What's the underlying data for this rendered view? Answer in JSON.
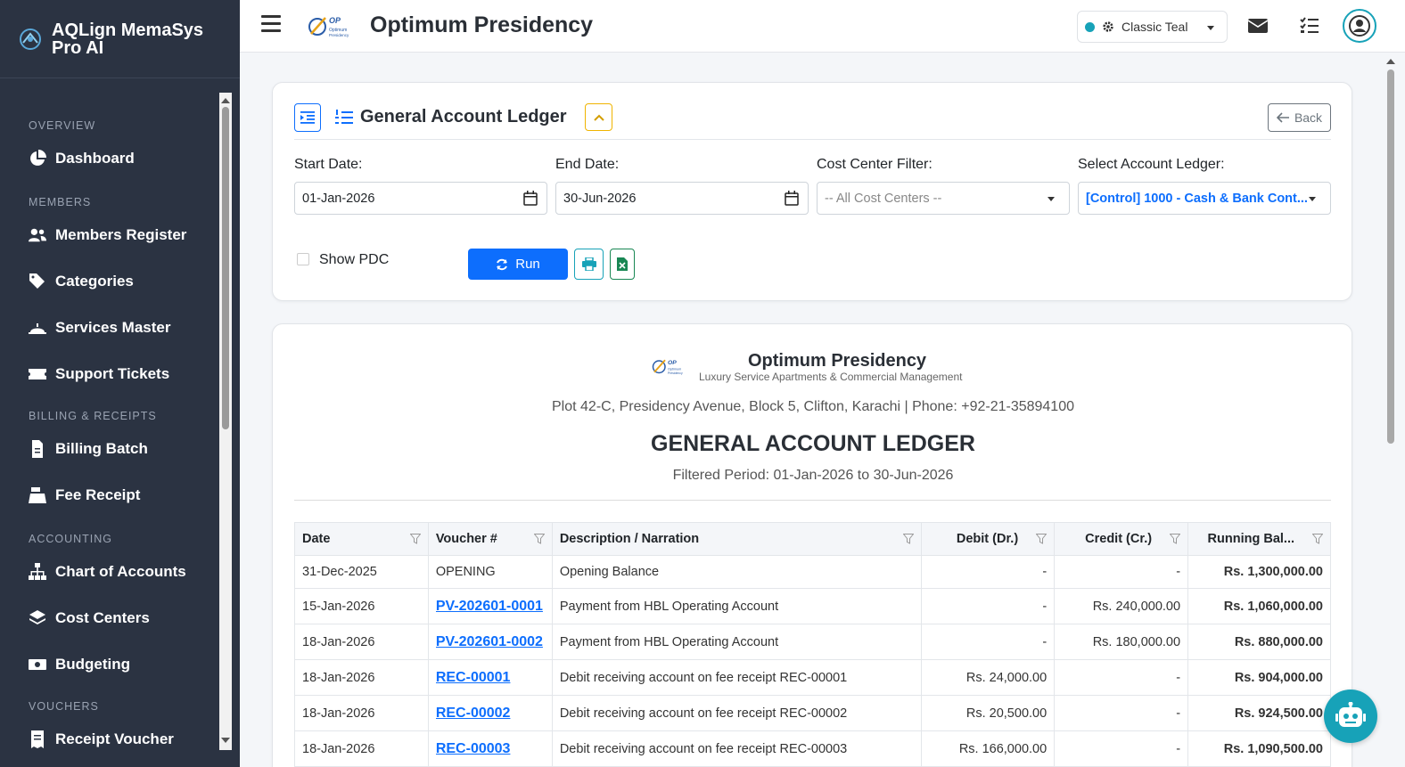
{
  "app": {
    "title": "AQLign MemaSys Pro AI"
  },
  "sidebar": {
    "sections": [
      {
        "label": "OVERVIEW"
      },
      {
        "label": "MEMBERS"
      },
      {
        "label": "BILLING & RECEIPTS"
      },
      {
        "label": "ACCOUNTING"
      },
      {
        "label": "VOUCHERS"
      }
    ],
    "items": [
      {
        "label": "Dashboard",
        "icon": "chart-pie-icon"
      },
      {
        "label": "Members Register",
        "icon": "users-icon"
      },
      {
        "label": "Categories",
        "icon": "tags-icon"
      },
      {
        "label": "Services Master",
        "icon": "service-bell-icon"
      },
      {
        "label": "Support Tickets",
        "icon": "ticket-icon"
      },
      {
        "label": "Billing Batch",
        "icon": "file-invoice-icon"
      },
      {
        "label": "Fee Receipt",
        "icon": "cash-register-icon"
      },
      {
        "label": "Chart of Accounts",
        "icon": "sitemap-icon"
      },
      {
        "label": "Cost Centers",
        "icon": "layers-icon"
      },
      {
        "label": "Budgeting",
        "icon": "money-bill-icon"
      },
      {
        "label": "Receipt Voucher",
        "icon": "receipt-icon"
      }
    ]
  },
  "topbar": {
    "org_name": "Optimum Presidency",
    "theme": {
      "label": "Classic Teal",
      "color": "#17a2b8"
    }
  },
  "filters": {
    "heading": "General Account Ledger",
    "back_label": "Back",
    "start_date_label": "Start Date:",
    "start_date": "01-Jan-2026",
    "end_date_label": "End Date:",
    "end_date": "30-Jun-2026",
    "cost_center_label": "Cost Center Filter:",
    "cost_center": "-- All Cost Centers --",
    "ledger_label": "Select Account Ledger:",
    "ledger": "[Control] 1000 - Cash & Bank Cont...",
    "show_pdc_label": "Show PDC",
    "show_pdc": false,
    "run_label": "Run"
  },
  "report": {
    "org_name": "Optimum Presidency",
    "org_tagline": "Luxury Service Apartments & Commercial Management",
    "address": "Plot 42-C, Presidency Avenue, Block 5, Clifton, Karachi | Phone: +92-21-35894100",
    "title": "GENERAL ACCOUNT LEDGER",
    "period": "Filtered Period: 01-Jan-2026 to 30-Jun-2026",
    "columns": [
      "Date",
      "Voucher #",
      "Description / Narration",
      "Debit (Dr.)",
      "Credit (Cr.)",
      "Running Bal..."
    ],
    "rows": [
      {
        "date": "31-Dec-2025",
        "voucher": "OPENING",
        "link": false,
        "desc": "Opening Balance",
        "debit": "-",
        "credit": "-",
        "balance": "Rs. 1,300,000.00"
      },
      {
        "date": "15-Jan-2026",
        "voucher": "PV-202601-0001",
        "link": true,
        "desc": "Payment from HBL Operating Account",
        "debit": "-",
        "credit": "Rs. 240,000.00",
        "balance": "Rs. 1,060,000.00"
      },
      {
        "date": "18-Jan-2026",
        "voucher": "PV-202601-0002",
        "link": true,
        "desc": "Payment from HBL Operating Account",
        "debit": "-",
        "credit": "Rs. 180,000.00",
        "balance": "Rs. 880,000.00"
      },
      {
        "date": "18-Jan-2026",
        "voucher": "REC-00001",
        "link": true,
        "desc": "Debit receiving account on fee receipt REC-00001",
        "debit": "Rs. 24,000.00",
        "credit": "-",
        "balance": "Rs. 904,000.00"
      },
      {
        "date": "18-Jan-2026",
        "voucher": "REC-00002",
        "link": true,
        "desc": "Debit receiving account on fee receipt REC-00002",
        "debit": "Rs. 20,500.00",
        "credit": "-",
        "balance": "Rs. 924,500.00"
      },
      {
        "date": "18-Jan-2026",
        "voucher": "REC-00003",
        "link": true,
        "desc": "Debit receiving account on fee receipt REC-00003",
        "debit": "Rs. 166,000.00",
        "credit": "-",
        "balance": "Rs. 1,090,500.00"
      }
    ]
  }
}
